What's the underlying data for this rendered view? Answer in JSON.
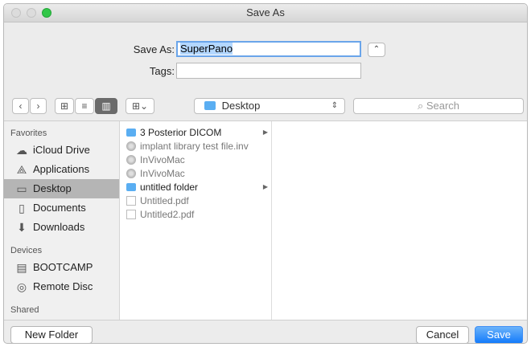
{
  "window": {
    "title": "Save As"
  },
  "form": {
    "save_as_label": "Save As:",
    "save_as_value": "SuperPano",
    "tags_label": "Tags:",
    "tags_value": ""
  },
  "toolbar": {
    "back_glyph": "‹",
    "forward_glyph": "›",
    "view_icon_glyph": "⊞",
    "view_list_glyph": "≡",
    "view_column_glyph": "▥",
    "arrange_glyph": "⊞⌄",
    "location": "Desktop",
    "search_placeholder": "Search"
  },
  "sidebar": {
    "favorites_label": "Favorites",
    "favorites": [
      {
        "label": "iCloud Drive",
        "icon": "cloud-icon",
        "glyph": "☁"
      },
      {
        "label": "Applications",
        "icon": "applications-icon",
        "glyph": "⟁"
      },
      {
        "label": "Desktop",
        "icon": "desktop-icon",
        "glyph": "▭",
        "active": true
      },
      {
        "label": "Documents",
        "icon": "documents-icon",
        "glyph": "▯"
      },
      {
        "label": "Downloads",
        "icon": "downloads-icon",
        "glyph": "⬇"
      }
    ],
    "devices_label": "Devices",
    "devices": [
      {
        "label": "BOOTCAMP",
        "icon": "disk-icon",
        "glyph": "▤"
      },
      {
        "label": "Remote Disc",
        "icon": "disc-icon",
        "glyph": "◎"
      }
    ],
    "shared_label": "Shared"
  },
  "files": [
    {
      "name": "3 Posterior DICOM",
      "type": "folder",
      "has_children": true
    },
    {
      "name": "implant library test file.inv",
      "type": "disc",
      "dim": true
    },
    {
      "name": "InVivoMac",
      "type": "disc",
      "dim": true
    },
    {
      "name": "InVivoMac",
      "type": "disc",
      "dim": true
    },
    {
      "name": "untitled folder",
      "type": "folder",
      "has_children": true
    },
    {
      "name": "Untitled.pdf",
      "type": "doc",
      "dim": true
    },
    {
      "name": "Untitled2.pdf",
      "type": "doc",
      "dim": true
    }
  ],
  "buttons": {
    "new_folder": "New Folder",
    "cancel": "Cancel",
    "save": "Save"
  },
  "colors": {
    "accent": "#147bfb",
    "folder": "#5aaef2",
    "selection": "#b5b5b5"
  }
}
